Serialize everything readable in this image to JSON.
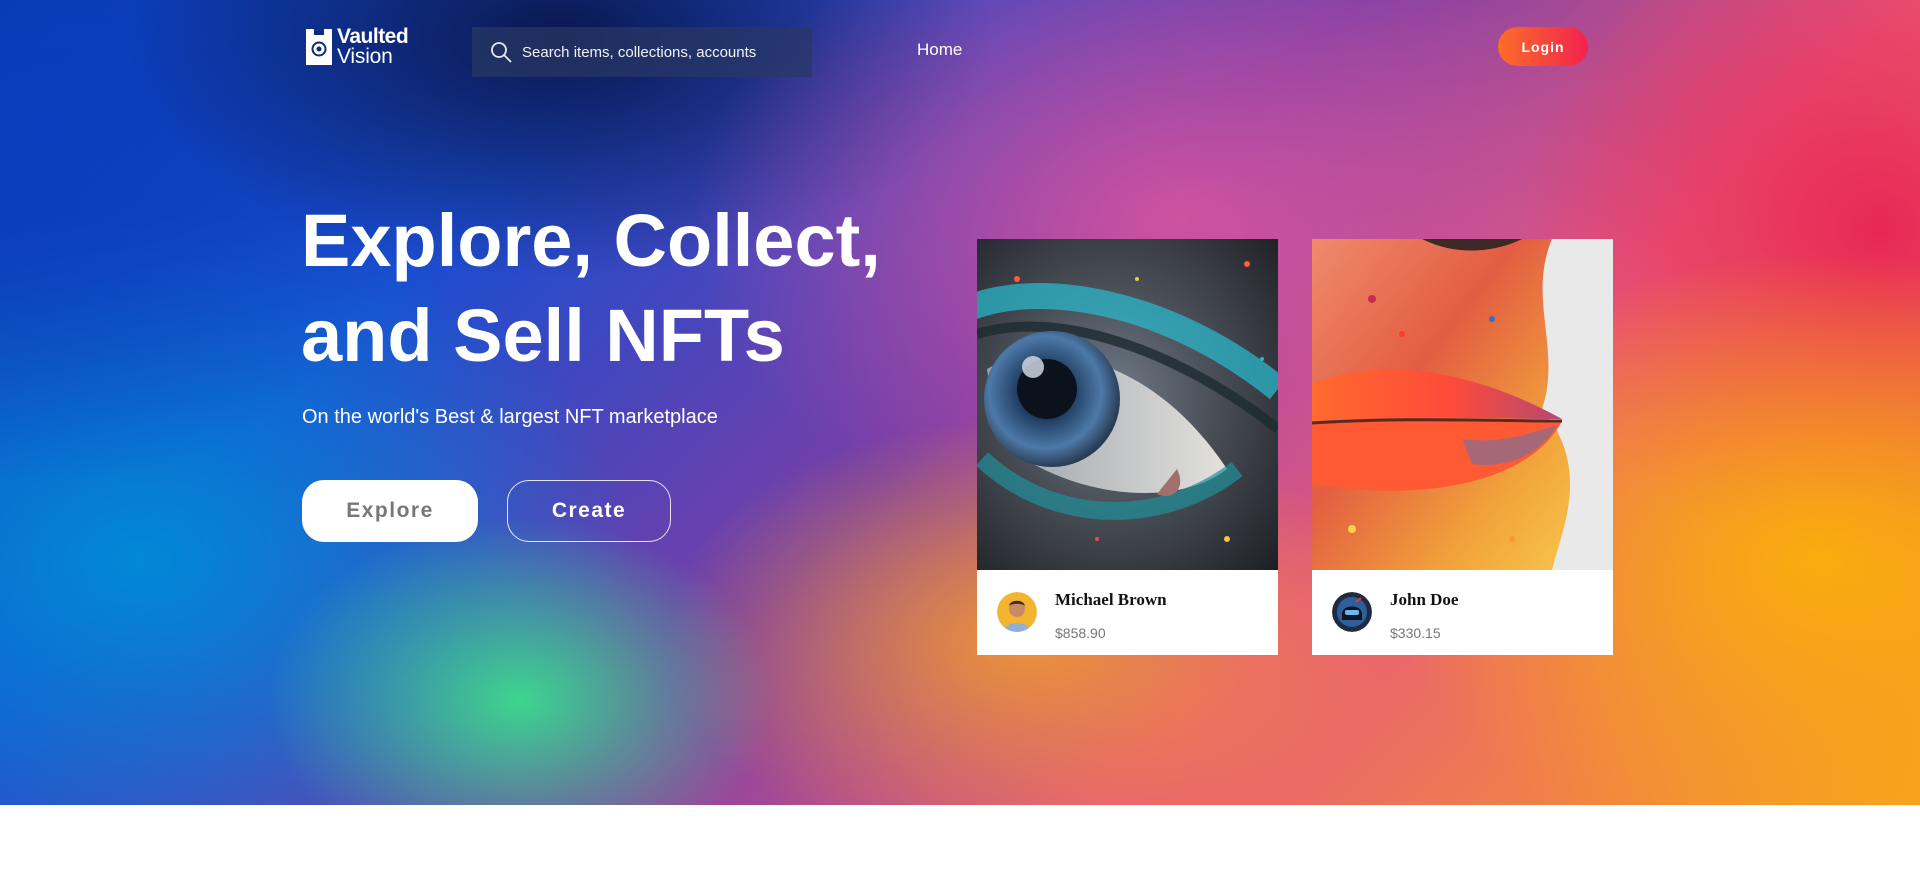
{
  "brand": {
    "line1": "Vaulted",
    "line2": "Vision",
    "icon": "vault-logo-icon"
  },
  "search": {
    "placeholder": "Search items, collections, accounts",
    "value": "",
    "icon": "search-icon"
  },
  "nav": {
    "home_label": "Home"
  },
  "header": {
    "login_label": "Login"
  },
  "hero": {
    "title_line1": "Explore, Collect,",
    "title_line2": "and Sell NFTs",
    "subtitle": "On the world's Best & largest NFT marketplace",
    "explore_label": "Explore",
    "create_label": "Create"
  },
  "cards": [
    {
      "artwork": "glitter-eye-artwork",
      "avatar": "man-avatar",
      "name": "Michael Brown",
      "price": "$858.90"
    },
    {
      "artwork": "color-powder-lips-artwork",
      "avatar": "helmet-avatar",
      "name": "John Doe",
      "price": "$330.15"
    }
  ],
  "colors": {
    "login_gradient": [
      "#fb6e28",
      "#f3214f"
    ],
    "hero_blue": "#0b3aa8",
    "hero_pink": "#e82456",
    "hero_orange": "#f7a21e",
    "hero_green": "#3cdc8c"
  }
}
